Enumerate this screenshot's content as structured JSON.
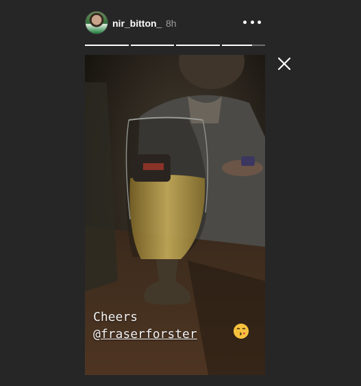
{
  "story": {
    "username": "nir_bitton_",
    "time": "8h",
    "more_icon": "more-horizontal-icon",
    "close_icon": "close-icon",
    "progress": [
      1,
      1,
      1,
      0.7
    ],
    "caption": {
      "line1": "Cheers",
      "at": "@",
      "mention": "fraserforster"
    },
    "emoji": "kissing-heart-emoji"
  }
}
